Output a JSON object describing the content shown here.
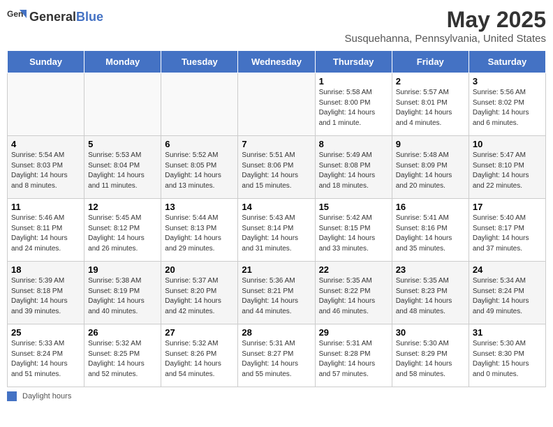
{
  "header": {
    "logo_general": "General",
    "logo_blue": "Blue",
    "title": "May 2025",
    "subtitle": "Susquehanna, Pennsylvania, United States"
  },
  "days": [
    "Sunday",
    "Monday",
    "Tuesday",
    "Wednesday",
    "Thursday",
    "Friday",
    "Saturday"
  ],
  "weeks": [
    [
      {
        "date": "",
        "info": ""
      },
      {
        "date": "",
        "info": ""
      },
      {
        "date": "",
        "info": ""
      },
      {
        "date": "",
        "info": ""
      },
      {
        "date": "1",
        "info": "Sunrise: 5:58 AM\nSunset: 8:00 PM\nDaylight: 14 hours\nand 1 minute."
      },
      {
        "date": "2",
        "info": "Sunrise: 5:57 AM\nSunset: 8:01 PM\nDaylight: 14 hours\nand 4 minutes."
      },
      {
        "date": "3",
        "info": "Sunrise: 5:56 AM\nSunset: 8:02 PM\nDaylight: 14 hours\nand 6 minutes."
      }
    ],
    [
      {
        "date": "4",
        "info": "Sunrise: 5:54 AM\nSunset: 8:03 PM\nDaylight: 14 hours\nand 8 minutes."
      },
      {
        "date": "5",
        "info": "Sunrise: 5:53 AM\nSunset: 8:04 PM\nDaylight: 14 hours\nand 11 minutes."
      },
      {
        "date": "6",
        "info": "Sunrise: 5:52 AM\nSunset: 8:05 PM\nDaylight: 14 hours\nand 13 minutes."
      },
      {
        "date": "7",
        "info": "Sunrise: 5:51 AM\nSunset: 8:06 PM\nDaylight: 14 hours\nand 15 minutes."
      },
      {
        "date": "8",
        "info": "Sunrise: 5:49 AM\nSunset: 8:08 PM\nDaylight: 14 hours\nand 18 minutes."
      },
      {
        "date": "9",
        "info": "Sunrise: 5:48 AM\nSunset: 8:09 PM\nDaylight: 14 hours\nand 20 minutes."
      },
      {
        "date": "10",
        "info": "Sunrise: 5:47 AM\nSunset: 8:10 PM\nDaylight: 14 hours\nand 22 minutes."
      }
    ],
    [
      {
        "date": "11",
        "info": "Sunrise: 5:46 AM\nSunset: 8:11 PM\nDaylight: 14 hours\nand 24 minutes."
      },
      {
        "date": "12",
        "info": "Sunrise: 5:45 AM\nSunset: 8:12 PM\nDaylight: 14 hours\nand 26 minutes."
      },
      {
        "date": "13",
        "info": "Sunrise: 5:44 AM\nSunset: 8:13 PM\nDaylight: 14 hours\nand 29 minutes."
      },
      {
        "date": "14",
        "info": "Sunrise: 5:43 AM\nSunset: 8:14 PM\nDaylight: 14 hours\nand 31 minutes."
      },
      {
        "date": "15",
        "info": "Sunrise: 5:42 AM\nSunset: 8:15 PM\nDaylight: 14 hours\nand 33 minutes."
      },
      {
        "date": "16",
        "info": "Sunrise: 5:41 AM\nSunset: 8:16 PM\nDaylight: 14 hours\nand 35 minutes."
      },
      {
        "date": "17",
        "info": "Sunrise: 5:40 AM\nSunset: 8:17 PM\nDaylight: 14 hours\nand 37 minutes."
      }
    ],
    [
      {
        "date": "18",
        "info": "Sunrise: 5:39 AM\nSunset: 8:18 PM\nDaylight: 14 hours\nand 39 minutes."
      },
      {
        "date": "19",
        "info": "Sunrise: 5:38 AM\nSunset: 8:19 PM\nDaylight: 14 hours\nand 40 minutes."
      },
      {
        "date": "20",
        "info": "Sunrise: 5:37 AM\nSunset: 8:20 PM\nDaylight: 14 hours\nand 42 minutes."
      },
      {
        "date": "21",
        "info": "Sunrise: 5:36 AM\nSunset: 8:21 PM\nDaylight: 14 hours\nand 44 minutes."
      },
      {
        "date": "22",
        "info": "Sunrise: 5:35 AM\nSunset: 8:22 PM\nDaylight: 14 hours\nand 46 minutes."
      },
      {
        "date": "23",
        "info": "Sunrise: 5:35 AM\nSunset: 8:23 PM\nDaylight: 14 hours\nand 48 minutes."
      },
      {
        "date": "24",
        "info": "Sunrise: 5:34 AM\nSunset: 8:24 PM\nDaylight: 14 hours\nand 49 minutes."
      }
    ],
    [
      {
        "date": "25",
        "info": "Sunrise: 5:33 AM\nSunset: 8:24 PM\nDaylight: 14 hours\nand 51 minutes."
      },
      {
        "date": "26",
        "info": "Sunrise: 5:32 AM\nSunset: 8:25 PM\nDaylight: 14 hours\nand 52 minutes."
      },
      {
        "date": "27",
        "info": "Sunrise: 5:32 AM\nSunset: 8:26 PM\nDaylight: 14 hours\nand 54 minutes."
      },
      {
        "date": "28",
        "info": "Sunrise: 5:31 AM\nSunset: 8:27 PM\nDaylight: 14 hours\nand 55 minutes."
      },
      {
        "date": "29",
        "info": "Sunrise: 5:31 AM\nSunset: 8:28 PM\nDaylight: 14 hours\nand 57 minutes."
      },
      {
        "date": "30",
        "info": "Sunrise: 5:30 AM\nSunset: 8:29 PM\nDaylight: 14 hours\nand 58 minutes."
      },
      {
        "date": "31",
        "info": "Sunrise: 5:30 AM\nSunset: 8:30 PM\nDaylight: 15 hours\nand 0 minutes."
      }
    ]
  ],
  "footer": {
    "legend_label": "Daylight hours"
  }
}
